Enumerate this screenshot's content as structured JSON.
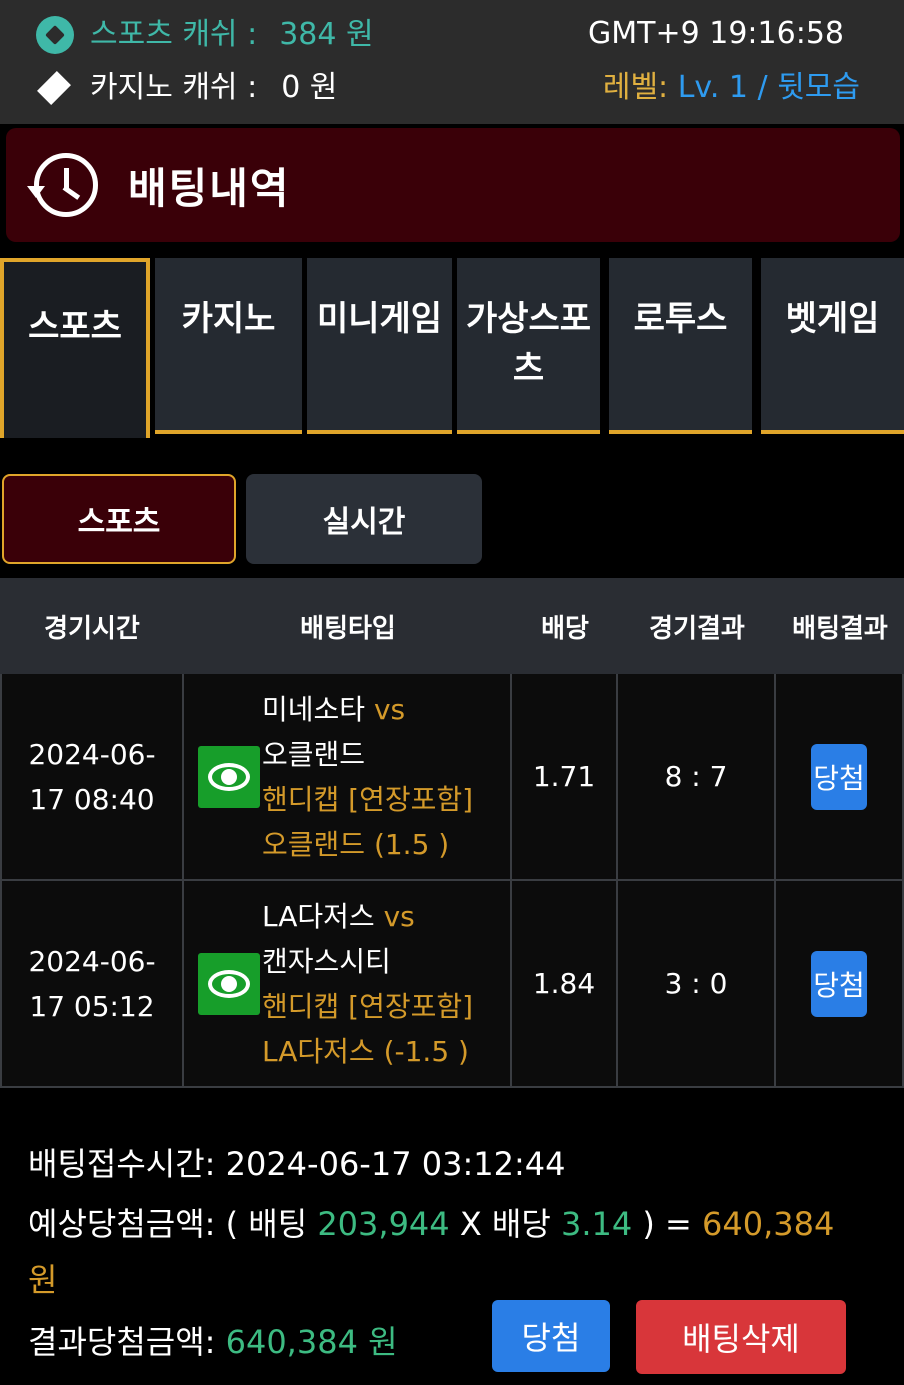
{
  "status_bar": {
    "sports_cash_label": "스포츠 캐쉬 :",
    "sports_cash_value": "384 원",
    "casino_cash_label": "카지노 캐쉬 :",
    "casino_cash_value": "0 원",
    "clock": "GMT+9 19:16:58",
    "level_label": "레벨:",
    "level_value": "Lv. 1 / 뒷모습"
  },
  "header": {
    "title": "배팅내역"
  },
  "tabs": [
    {
      "label": "스포츠",
      "active": true
    },
    {
      "label": "카지노"
    },
    {
      "label": "미니게임"
    },
    {
      "label": "가상스포츠",
      "line1": "가상스포",
      "line2": "츠"
    },
    {
      "label": "로투스"
    },
    {
      "label": "벳게임"
    }
  ],
  "subtabs": [
    {
      "label": "스포츠",
      "active": true
    },
    {
      "label": "실시간"
    }
  ],
  "table": {
    "headers": [
      "경기시간",
      "배팅타입",
      "배당",
      "경기결과",
      "배팅결과"
    ],
    "rows": [
      {
        "date_line1": "2024-06-",
        "date_line2": "17 08:40",
        "home": "미네소타",
        "vs": "vs",
        "away": "오클랜드",
        "market": "핸디캡 [연장포함]",
        "pick": "오클랜드 (1.5 )",
        "odds": "1.71",
        "score": "8 : 7",
        "result": "당첨"
      },
      {
        "date_line1": "2024-06-",
        "date_line2": "17 05:12",
        "home": "LA다저스",
        "vs": "vs",
        "away": "캔자스시티",
        "market": "핸디캡 [연장포함]",
        "pick": "LA다저스 (-1.5 )",
        "odds": "1.84",
        "score": "3 : 0",
        "result": "당첨"
      }
    ]
  },
  "summary": {
    "received_label": "배팅접수시간:",
    "received_value": "2024-06-17 03:12:44",
    "expected_label": "예상당첨금액:",
    "open_paren": "(",
    "bet_label": "배팅",
    "bet_value": "203,944",
    "times": "X",
    "odds_label": "배당",
    "odds_value": "3.14",
    "close_paren": ") =",
    "expected_value": "640,384",
    "won_unit": "원",
    "result_label": "결과당첨금액:",
    "result_value": "640,384 원"
  },
  "buttons": {
    "win": "당첨",
    "delete": "배팅삭제"
  },
  "colors": {
    "teal": "#3fb8a8",
    "gold": "#e0b040",
    "blue": "#2e9bf0",
    "green": "#3dbb82",
    "orange": "#d49a2a",
    "header_bg": "#3a0008",
    "delete_red": "#d8363a"
  },
  "icons": [
    "soccer-ball-icon",
    "diamond-icon",
    "history-clock-icon",
    "eye-icon"
  ]
}
